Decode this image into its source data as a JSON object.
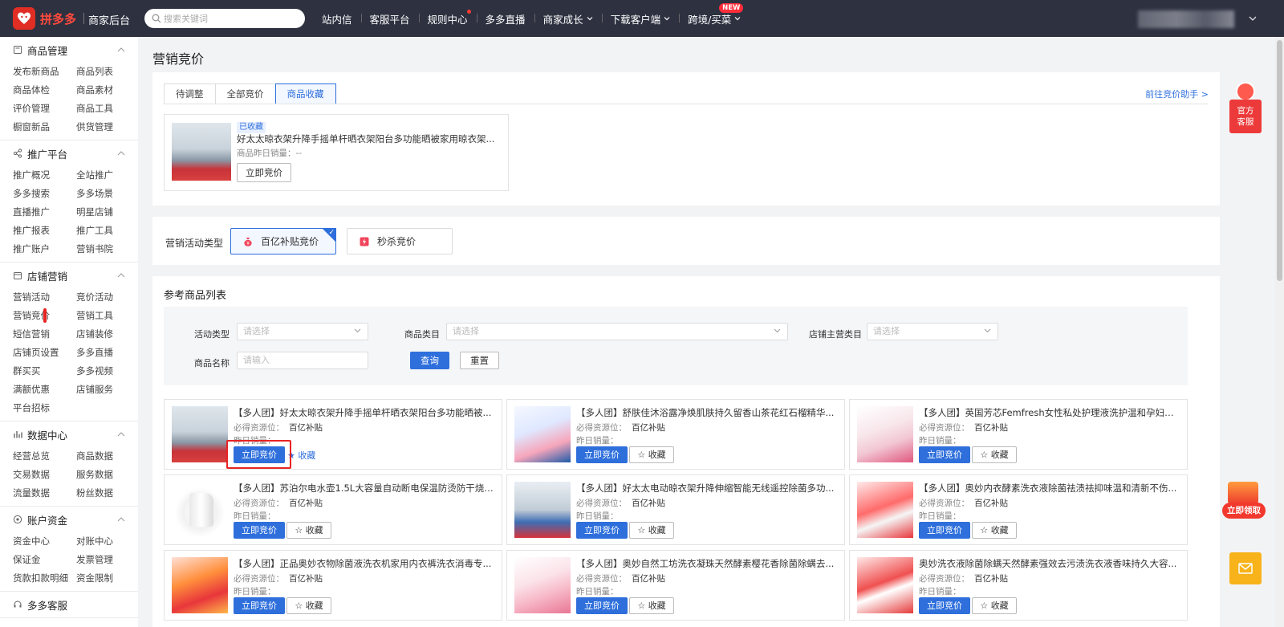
{
  "header": {
    "brand": "拼多多",
    "subtitle": "商家后台",
    "search_placeholder": "搜索关键词",
    "nav": [
      {
        "label": "站内信"
      },
      {
        "label": "客服平台"
      },
      {
        "label": "规则中心"
      },
      {
        "label": "多多直播"
      },
      {
        "label": "商家成长"
      },
      {
        "label": "下载客户端"
      },
      {
        "label": "跨境/买菜"
      }
    ],
    "new_badge": "NEW"
  },
  "sidebar": {
    "sections": [
      {
        "title": "商品管理",
        "items": [
          "发布新商品",
          "商品列表",
          "商品体检",
          "商品素材",
          "评价管理",
          "商品工具",
          "橱窗新品",
          "供货管理"
        ]
      },
      {
        "title": "推广平台",
        "items": [
          "推广概况",
          "全站推广",
          "多多搜索",
          "多多场景",
          "直播推广",
          "明星店铺",
          "推广报表",
          "推广工具",
          "推广账户",
          "营销书院"
        ]
      },
      {
        "title": "店铺营销",
        "items": [
          "营销活动",
          "竞价活动",
          "营销竞价",
          "营销工具",
          "短信营销",
          "店铺装修",
          "店铺页设置",
          "多多直播",
          "群买买",
          "多多视频",
          "满额优惠",
          "店铺服务",
          "平台招标"
        ]
      },
      {
        "title": "数据中心",
        "items": [
          "经营总览",
          "商品数据",
          "交易数据",
          "服务数据",
          "流量数据",
          "粉丝数据"
        ]
      },
      {
        "title": "账户资金",
        "items": [
          "资金中心",
          "对账中心",
          "保证金",
          "发票管理",
          "货款扣款明细",
          "资金限制"
        ]
      },
      {
        "title": "多多客服",
        "items": []
      }
    ]
  },
  "main": {
    "page_title": "营销竞价",
    "tabs": [
      "待调整",
      "全部竞价",
      "商品收藏"
    ],
    "assist_link": "前往竞价助手 >",
    "favorite": {
      "tag": "已收藏",
      "title": "好太太晾衣架升降手摇单杆晒衣架阳台多功能晒被家用晾衣架...",
      "sales": "商品昨日销量：--",
      "button": "立即竞价"
    },
    "activity": {
      "label": "营销活动类型",
      "options": [
        "百亿补贴竞价",
        "秒杀竞价"
      ]
    },
    "list": {
      "title": "参考商品列表",
      "filters": {
        "activity_type_label": "活动类型",
        "activity_type_placeholder": "请选择",
        "category_label": "商品类目",
        "category_placeholder": "请选择",
        "shop_category_label": "店铺主营类目",
        "shop_category_placeholder": "请选择",
        "name_label": "商品名称",
        "name_placeholder": "请输入",
        "query": "查询",
        "reset": "重置"
      },
      "must_label": "必得资源位：",
      "sales_label": "昨日销量：",
      "bid_label": "立即竞价",
      "fav_label": "收藏",
      "products": [
        {
          "title": "【多人团】好太太晾衣架升降手摇单杆晒衣架阳台多功能晒被...",
          "resource": "百亿补贴",
          "faved": true
        },
        {
          "title": "【多人团】舒肤佳沐浴露净焕肌肤持久留香山茶花红石榴精华...",
          "resource": "百亿补贴",
          "faved": false
        },
        {
          "title": "【多人团】英国芳芯Femfresh女性私处护理液洗护温和孕妇私...",
          "resource": "百亿补贴",
          "faved": false
        },
        {
          "title": "【多人团】苏泊尔电水壶1.5L大容量自动断电保温防烫防干烧自...",
          "resource": "百亿补贴",
          "faved": false
        },
        {
          "title": "【多人团】好太太电动晾衣架升降伸缩智能无线遥控除菌多功...",
          "resource": "百亿补贴",
          "faved": false
        },
        {
          "title": "【多人团】奥妙内衣酵素洗衣液除菌祛渍祛抑味温和清新不伤...",
          "resource": "百亿补贴",
          "faved": false
        },
        {
          "title": "【多人团】正品奥妙衣物除菌液洗衣机家用内衣裤洗衣消毒专...",
          "resource": "百亿补贴",
          "faved": false
        },
        {
          "title": "【多人团】奥妙自然工坊洗衣凝珠天然酵素樱花香除菌除螨去...",
          "resource": "百亿补贴",
          "faved": false
        },
        {
          "title": "奥妙洗衣液除菌除螨天然酵素强效去污渍洗衣液香味持久大容...",
          "resource": "百亿补贴",
          "faved": false
        }
      ],
      "faved_label": "收藏"
    }
  },
  "floaters": {
    "service": "官方\n客服",
    "gift": "立即领取"
  },
  "colors": {
    "primary": "#2e6fdc",
    "topbar": "#2d3140",
    "brand_red": "#e02e24"
  }
}
